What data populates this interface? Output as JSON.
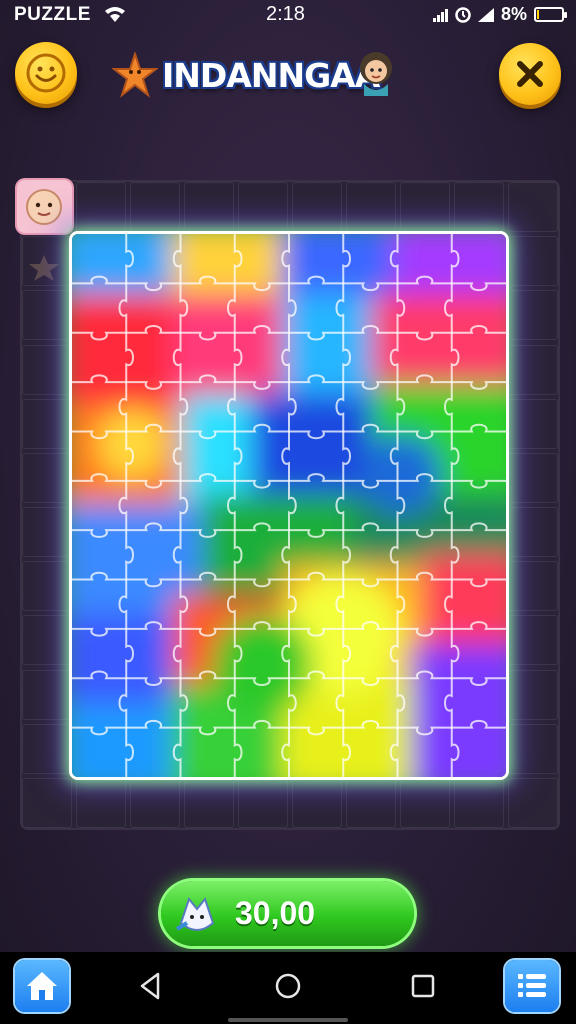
{
  "status_bar": {
    "app_name": "PUZZLE",
    "time": "2:18",
    "battery": "8%",
    "battery_level": 0.08
  },
  "header": {
    "title": "INDANNGAA",
    "left_button_icon": "smiley-face-icon",
    "right_button_icon": "close-icon",
    "title_icons": [
      "starfish-icon",
      "girl-character-icon"
    ]
  },
  "board": {
    "columns": 8,
    "rows": 10,
    "placed_columns": 8,
    "placed_rows": 11,
    "side_chip_icon": "baby-face-icon"
  },
  "bottom": {
    "coin_button_label": "30,00",
    "coin_button_icon": "cat-mascot-icon"
  },
  "navbar": {
    "left_icon": "home-icon",
    "right_icon": "menu-list-icon",
    "system_icons": [
      "back-icon",
      "home-circle-icon",
      "recents-icon"
    ]
  },
  "colors": {
    "accent_yellow": "#ffc21a",
    "glow_green": "#8cff8c",
    "button_green": "#2fc81f",
    "nav_blue": "#1d7ef0",
    "background": "#2a1f38"
  }
}
